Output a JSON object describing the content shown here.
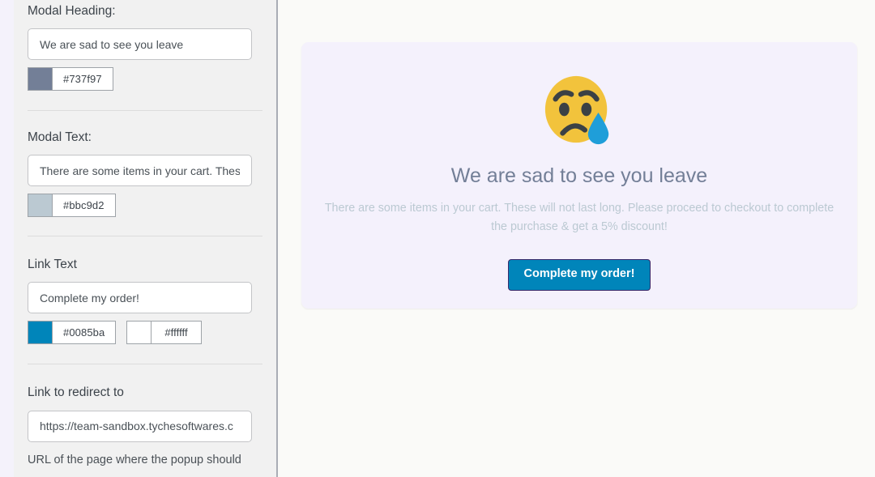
{
  "sidebar": {
    "fields": [
      {
        "label": "Modal Heading:",
        "input_value": "We are sad to see you leave",
        "colors": [
          {
            "hex": "#737f97",
            "label": "#737f97"
          }
        ]
      },
      {
        "label": "Modal Text:",
        "input_value": "There are some items in your cart. Thes",
        "colors": [
          {
            "hex": "#bbc9d2",
            "label": "#bbc9d2"
          }
        ]
      },
      {
        "label": "Link Text",
        "input_value": "Complete my order!",
        "colors": [
          {
            "hex": "#0085ba",
            "label": "#0085ba"
          },
          {
            "hex": "#ffffff",
            "label": "#ffffff"
          }
        ]
      },
      {
        "label": "Link to redirect to",
        "input_value": "https://team-sandbox.tychesoftwares.c",
        "help": "URL of the page where the popup should"
      }
    ]
  },
  "preview": {
    "emoji_name": "crying-face-emoji",
    "heading": "We are sad to see you leave",
    "heading_color": "#737f97",
    "body": "There are some items in your cart. These will not last long. Please proceed to checkout to complete the purchase & get a 5% discount!",
    "body_color": "#bbc9d2",
    "button_label": "Complete my order!",
    "button_bg": "#0085ba",
    "button_text_color": "#ffffff",
    "card_bg": "#f4f1fc"
  }
}
